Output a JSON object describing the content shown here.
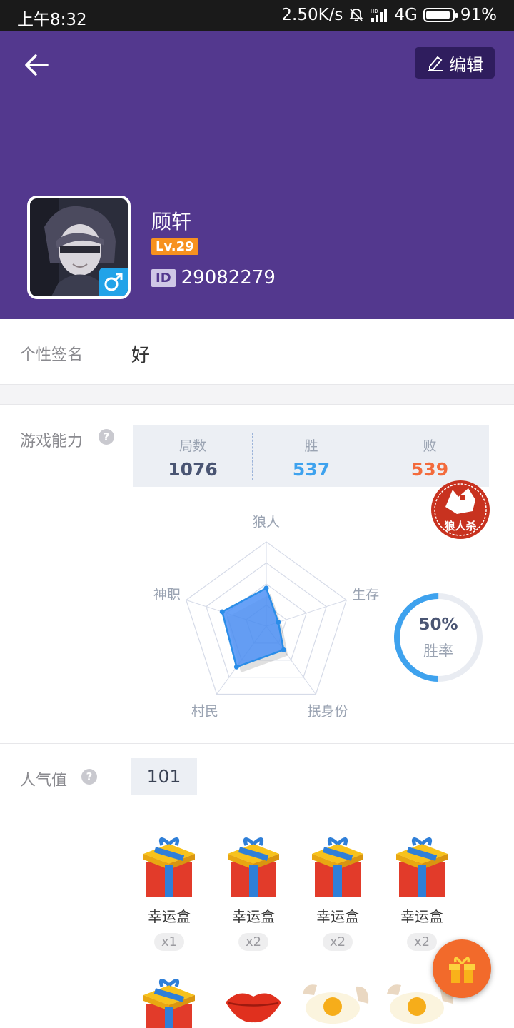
{
  "status_bar": {
    "time": "上午8:32",
    "network_speed": "2.50K/s",
    "network_type": "4G",
    "battery": "91%",
    "battery_level": 0.91
  },
  "header": {
    "edit_label": "编辑",
    "nickname": "顾轩",
    "level": "Lv.29",
    "id_tag": "ID",
    "user_id": "29082279",
    "gender_icon": "male-symbol-icon",
    "colors": {
      "header_bg": "#53388e",
      "edit_bg": "#2f1d5e",
      "level_bg": "#f7911f"
    }
  },
  "signature": {
    "label": "个性签名",
    "value": "好"
  },
  "game_ability": {
    "label": "游戏能力",
    "help": "?",
    "stats": [
      {
        "label": "局数",
        "value": "1076",
        "color": "#4a5573"
      },
      {
        "label": "胜",
        "value": "537",
        "color": "#3ea2ee"
      },
      {
        "label": "败",
        "value": "539",
        "color": "#f36b3c"
      }
    ],
    "stamp_text": "狼人杀",
    "winrate": {
      "value": "50%",
      "label": "胜率",
      "fraction": 0.5
    }
  },
  "chart_data": {
    "type": "radar",
    "axes": [
      "狼人",
      "生存",
      "抿身份",
      "村民",
      "神职"
    ],
    "values": [
      0.45,
      0.15,
      0.35,
      0.6,
      0.55
    ],
    "max": 1
  },
  "popularity": {
    "label": "人气值",
    "help": "?",
    "value": "101",
    "gifts": [
      {
        "name": "幸运盒",
        "count": "x1",
        "icon": "gift-box-icon"
      },
      {
        "name": "幸运盒",
        "count": "x2",
        "icon": "gift-box-icon"
      },
      {
        "name": "幸运盒",
        "count": "x2",
        "icon": "gift-box-icon"
      },
      {
        "name": "幸运盒",
        "count": "x2",
        "icon": "gift-box-icon"
      }
    ],
    "gifts_row2": [
      "gift-box-icon",
      "lips-icon",
      "broken-egg-icon",
      "broken-egg-icon"
    ]
  }
}
